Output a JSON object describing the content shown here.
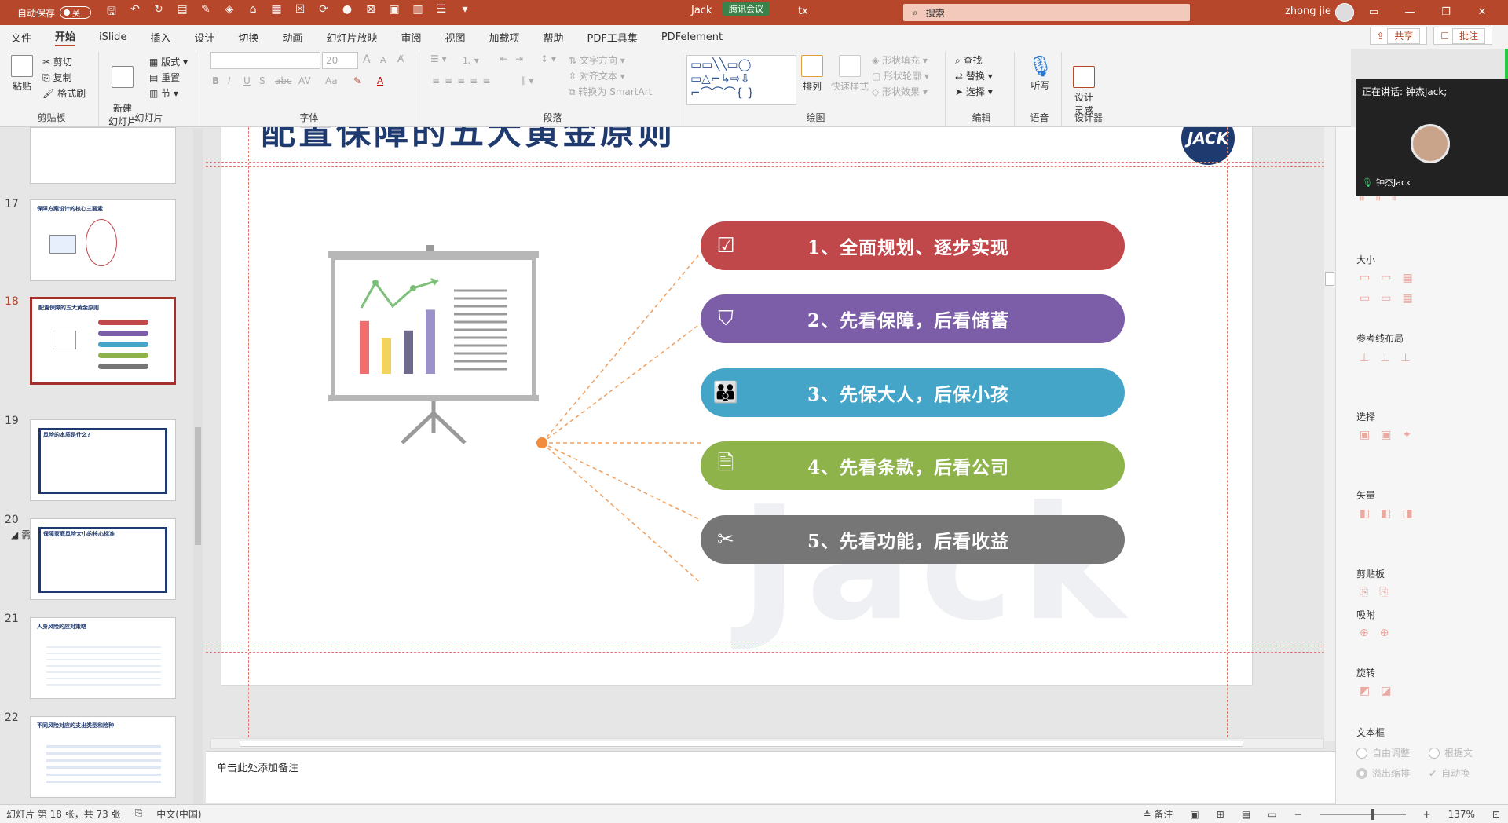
{
  "titlebar": {
    "autosave_label": "自动保存",
    "autosave_state": "关",
    "doc_title": "Jack",
    "meeting_label": "腾讯会议",
    "doc_suffix": "tx",
    "search_placeholder": "搜索",
    "user_name": "zhong jie",
    "window_buttons": [
      "—",
      "❐",
      "✕"
    ]
  },
  "tabs": [
    "文件",
    "开始",
    "iSlide",
    "插入",
    "设计",
    "切换",
    "动画",
    "幻灯片放映",
    "审阅",
    "视图",
    "加载项",
    "帮助",
    "PDF工具集",
    "PDFelement"
  ],
  "share": {
    "share_label": "共享",
    "comment_label": "批注"
  },
  "ribbon": {
    "clipboard": {
      "paste": "粘贴",
      "cut": "剪切",
      "copy": "复制",
      "format_painter": "格式刷",
      "label": "剪贴板"
    },
    "slides": {
      "new_slide": "新建\n幻灯片",
      "layout": "版式",
      "reset": "重置",
      "section": "节",
      "label": "幻灯片"
    },
    "font": {
      "size": "20",
      "label": "字体",
      "bold": "B",
      "italic": "I",
      "underline": "U",
      "shadow": "S",
      "strike": "abc",
      "spacing": "AV",
      "case": "Aa",
      "grow": "A",
      "shrink": "A"
    },
    "paragraph": {
      "text_direction": "文字方向",
      "align_text": "对齐文本",
      "smartart": "转换为 SmartArt",
      "label": "段落"
    },
    "drawing": {
      "arrange": "排列",
      "quick_styles": "快速样式",
      "shape_fill": "形状填充",
      "shape_outline": "形状轮廓",
      "shape_effects": "形状效果",
      "label": "绘图"
    },
    "editing": {
      "find": "查找",
      "replace": "替换",
      "select": "选择",
      "label": "编辑"
    },
    "voice": {
      "dictate": "听写",
      "label": "语音"
    },
    "designer": {
      "design_ideas": "设计\n灵感",
      "label": "设计器"
    }
  },
  "slide_panel": {
    "section_name": "需求分析",
    "thumbnails": [
      {
        "num": "",
        "title": ""
      },
      {
        "num": "17",
        "title": "保障方案设计的核心三要素"
      },
      {
        "num": "18",
        "title": "配置保障的五大黄金原则"
      },
      {
        "num": "19",
        "title": "风险的本质是什么?"
      },
      {
        "num": "20",
        "title": "保障家庭风险大小的核心标准"
      },
      {
        "num": "21",
        "title": "人身风险的应对策略"
      },
      {
        "num": "22",
        "title": "不同风险对应的支出类型和险种"
      }
    ]
  },
  "slide": {
    "title": "配置保障的五大黄金原则",
    "logo": "JACK",
    "watermark": "Jack",
    "principles": [
      {
        "text": "1、全面规划、逐步实现",
        "color": "#c0474a",
        "icon": "checkbox-icon",
        "glyph": "☑"
      },
      {
        "text": "2、先看保障，后看储蓄",
        "color": "#7b5ea7",
        "icon": "shield-icon",
        "glyph": "⛉"
      },
      {
        "text": "3、先保大人，后保小孩",
        "color": "#45a5c9",
        "icon": "family-icon",
        "glyph": "👪"
      },
      {
        "text": "4、先看条款，后看公司",
        "color": "#8db34a",
        "icon": "document-icon",
        "glyph": "🗎"
      },
      {
        "text": "5、先看功能，后看收益",
        "color": "#767676",
        "icon": "tools-icon",
        "glyph": "✂"
      }
    ],
    "chart_bars": [
      {
        "color": "#f26d6d",
        "value": 0.56
      },
      {
        "color": "#f2d45c",
        "value": 0.38
      },
      {
        "color": "#6d6a8a",
        "value": 0.46
      },
      {
        "color": "#9c92c9",
        "value": 0.68
      }
    ]
  },
  "notes_placeholder": "单击此处添加备注",
  "right_pane": {
    "sections": [
      "大小",
      "参考线布局",
      "选择",
      "矢量",
      "剪贴板",
      "吸附",
      "旋转",
      "文本框"
    ],
    "options": [
      "自由调整",
      "根据文",
      "溢出缩排",
      "自动换"
    ]
  },
  "meeting": {
    "speaking": "正在讲话: 钟杰Jack;",
    "participant": "钟杰Jack"
  },
  "statusbar": {
    "slide_info": "幻灯片 第 18 张，共 73 张",
    "language": "中文(中国)",
    "notes": "备注",
    "zoom": "137%"
  }
}
